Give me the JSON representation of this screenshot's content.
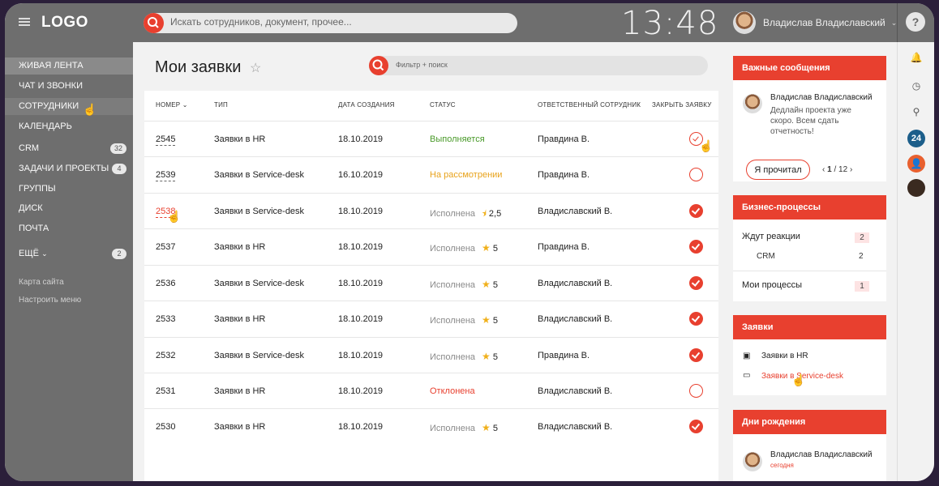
{
  "header": {
    "logo": "LOGO",
    "search_placeholder": "Искать сотрудников, документ, прочее...",
    "clock": "13:48",
    "user_name": "Владислав Владиславский",
    "help": "?"
  },
  "sidebar": {
    "items": [
      {
        "label": "Живая лента"
      },
      {
        "label": "Чат и звонки"
      },
      {
        "label": "Сотрудники"
      },
      {
        "label": "Календарь"
      },
      {
        "label": "CRM",
        "badge": "32"
      },
      {
        "label": "Задачи и проекты",
        "badge": "4"
      },
      {
        "label": "Группы"
      },
      {
        "label": "Диск"
      },
      {
        "label": "Почта"
      },
      {
        "label": "Ещё",
        "badge": "2"
      }
    ],
    "links": [
      "Карта сайта",
      "Настроить меню"
    ]
  },
  "main": {
    "title": "Мои заявки",
    "filter_placeholder": "Фильтр + поиск",
    "columns": [
      "Номер",
      "Тип",
      "Дата создания",
      "Статус",
      "Ответственный сотрудник",
      "Закрыть заявку"
    ],
    "rows": [
      {
        "num": "2545",
        "type": "Заявки в HR",
        "date": "18.10.2019",
        "status": "Выполняется",
        "rating": "",
        "owner": "Правдина В.",
        "closed": "partial"
      },
      {
        "num": "2539",
        "type": "Заявки в Service-desk",
        "date": "16.10.2019",
        "status": "На рассмотрении",
        "rating": "",
        "owner": "Правдина В.",
        "closed": "off"
      },
      {
        "num": "2538",
        "type": "Заявки в Service-desk",
        "date": "18.10.2019",
        "status": "Исполнена",
        "rating": "2,5",
        "owner": "Владиславский В.",
        "closed": "on"
      },
      {
        "num": "2537",
        "type": "Заявки в HR",
        "date": "18.10.2019",
        "status": "Исполнена",
        "rating": "5",
        "owner": "Правдина В.",
        "closed": "on"
      },
      {
        "num": "2536",
        "type": "Заявки в Service-desk",
        "date": "18.10.2019",
        "status": "Исполнена",
        "rating": "5",
        "owner": "Владиславский В.",
        "closed": "on"
      },
      {
        "num": "2533",
        "type": "Заявки в HR",
        "date": "18.10.2019",
        "status": "Исполнена",
        "rating": "5",
        "owner": "Владиславский В.",
        "closed": "on"
      },
      {
        "num": "2532",
        "type": "Заявки в Service-desk",
        "date": "18.10.2019",
        "status": "Исполнена",
        "rating": "5",
        "owner": "Правдина В.",
        "closed": "on"
      },
      {
        "num": "2531",
        "type": "Заявки в HR",
        "date": "18.10.2019",
        "status": "Отклонена",
        "rating": "",
        "owner": "Владиславский В.",
        "closed": "off"
      },
      {
        "num": "2530",
        "type": "Заявки в HR",
        "date": "18.10.2019",
        "status": "Исполнена",
        "rating": "5",
        "owner": "Владиславский В.",
        "closed": "on"
      }
    ]
  },
  "right": {
    "important": {
      "title": "Важные сообщения",
      "author": "Владислав Владиславский",
      "message": "Дедлайн проекта уже скоро. Всем сдать отчетность!",
      "read_btn": "Я прочитал",
      "pager_current": "1",
      "pager_total": "/ 12"
    },
    "business": {
      "title": "Бизнес-процессы",
      "wait": "Ждут реакции",
      "wait_count": "2",
      "crm": "CRM",
      "crm_count": "2",
      "my": "Мои процессы",
      "my_count": "1"
    },
    "requests": {
      "title": "Заявки",
      "hr": "Заявки в HR",
      "sd": "Заявки в Service-desk"
    },
    "birthdays": {
      "title": "Дни рождения",
      "name": "Владислав Владиславский",
      "when": "сегодня"
    }
  },
  "strip": {
    "badge24": "24"
  },
  "colors": {
    "accent": "#e8402f",
    "sidebar": "#6e6e6e",
    "green": "#4a9a2a",
    "orange": "#e8a21a"
  }
}
